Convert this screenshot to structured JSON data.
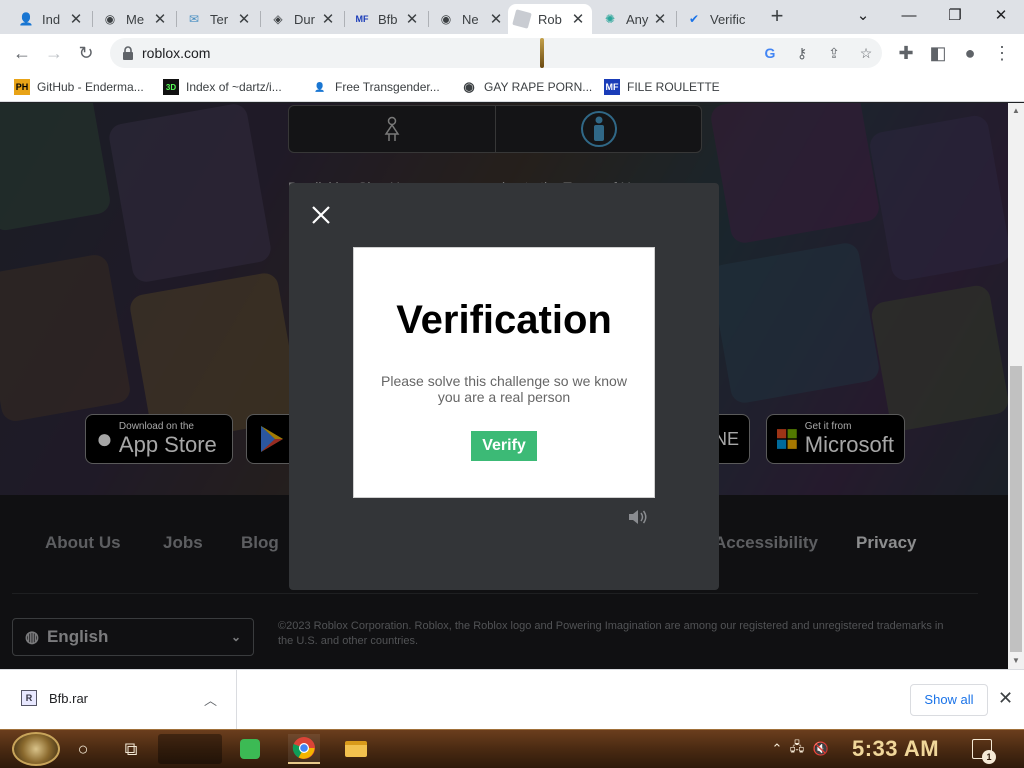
{
  "tabs": [
    {
      "title": "Ind",
      "icon": "user-badge-icon"
    },
    {
      "title": "Me",
      "icon": "web-globe-icon"
    },
    {
      "title": "Ter",
      "icon": "mail-icon"
    },
    {
      "title": "Dur",
      "icon": "diamond-icon"
    },
    {
      "title": "Bfb",
      "icon": "file-doc-icon"
    },
    {
      "title": "Ne",
      "icon": "web-globe-icon"
    },
    {
      "title": "Rob",
      "icon": "roblox-icon",
      "active": true
    },
    {
      "title": "Any",
      "icon": "gear-spark-icon"
    },
    {
      "title": "Verific",
      "icon": "checkmark-icon"
    }
  ],
  "toolbar": {
    "url": "roblox.com"
  },
  "bookmarks": [
    {
      "label": "GitHub - Enderma...",
      "icon_text": "PH"
    },
    {
      "label": "Index of ~dartz/i...",
      "icon_text": "3D"
    },
    {
      "label": "Free Transgender...",
      "icon_text": ""
    },
    {
      "label": "GAY RAPE PORN...",
      "icon_text": ""
    },
    {
      "label": "FILE ROULETTE",
      "icon_text": "MF"
    }
  ],
  "page": {
    "behind_text": "By clicking Sign Up, you are agreeing to the Terms of Use",
    "store_badges": {
      "appstore_small": "Download on the",
      "appstore_big": "App Store",
      "microsoft_small": "Get it from",
      "microsoft_big": "Microsoft",
      "partial_label": "NE"
    },
    "footer": {
      "links": [
        "About Us",
        "Jobs",
        "Blog",
        "Accessibility",
        "Privacy"
      ],
      "language": "English",
      "copyright": "©2023 Roblox Corporation. Roblox, the Roblox logo and Powering Imagination are among our registered and unregistered trademarks in the U.S. and other countries."
    }
  },
  "modal": {
    "title": "Verification",
    "message": "Please solve this challenge so we know you are a real person",
    "verify_label": "Verify"
  },
  "downloads": {
    "file": "Bfb.rar",
    "show_all": "Show all"
  },
  "taskbar": {
    "time": "5:33 AM",
    "notification_count": "1"
  },
  "colors": {
    "verify_green": "#3cba76",
    "modal_bg": "#333538",
    "chrome_tabstrip": "#dee1e6",
    "taskbar_brown": "#4a2a12"
  }
}
